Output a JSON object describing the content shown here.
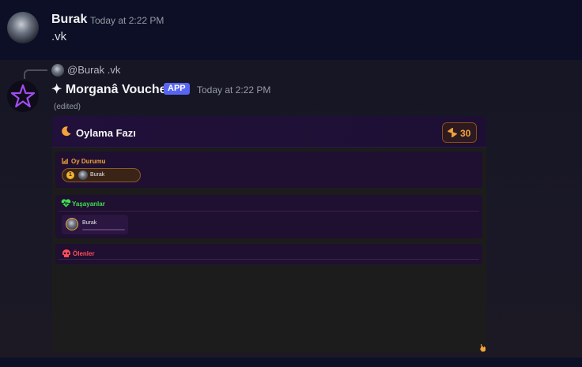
{
  "message1": {
    "username": "Burak",
    "timestamp": "Today at 2:22 PM",
    "content": ".vk"
  },
  "message2": {
    "reply": {
      "text": "@Burak .vk"
    },
    "username": "✦ Morganâ Voucher",
    "badge": "APP",
    "timestamp": "Today at 2:22 PM",
    "edited": "(edited)",
    "embed": {
      "title": "Oylama Fazı",
      "counter": "30",
      "vote_section": {
        "label": "Oy Durumu",
        "votes": [
          {
            "count": "1",
            "name": "Burak"
          }
        ]
      },
      "alive_section": {
        "label": "Yaşayanlar",
        "players": [
          {
            "name": "Burak"
          }
        ]
      },
      "dead_section": {
        "label": "Ölenler"
      }
    }
  },
  "colors": {
    "accent_orange": "#f2a33a",
    "alive_green": "#3ee04d",
    "dead_red": "#ff4d5a",
    "app_badge": "#5865f2"
  },
  "icons": {
    "moon": "moon-icon",
    "counter": "hourglass-icon",
    "vote": "chart-icon",
    "alive": "heartbeat-icon",
    "dead": "skull-icon"
  }
}
